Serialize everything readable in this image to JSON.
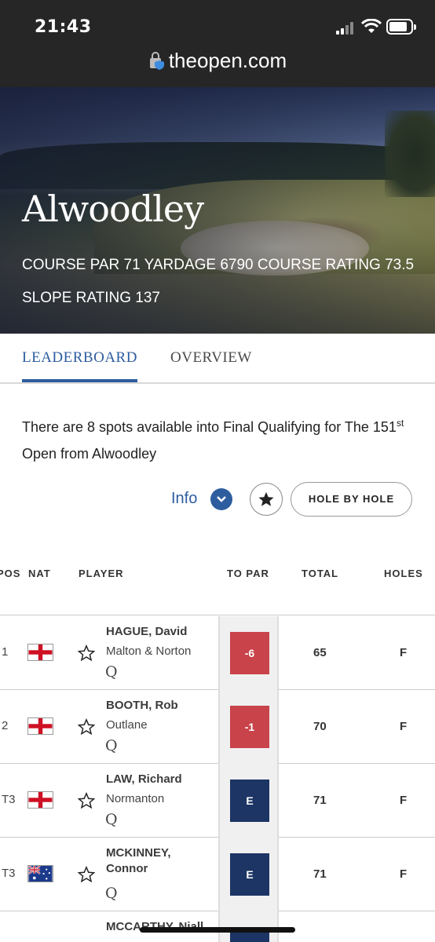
{
  "status_bar": {
    "time": "21:43"
  },
  "browser": {
    "url": "theopen.com"
  },
  "hero": {
    "title": "Alwoodley",
    "course_info": "COURSE PAR 71 YARDAGE 6790 COURSE RATING 73.5 SLOPE RATING 137"
  },
  "tabs": [
    {
      "label": "LEADERBOARD",
      "active": true
    },
    {
      "label": "OVERVIEW",
      "active": false
    }
  ],
  "intro": {
    "text_before": "There are 8 spots available into Final Qualifying for The 151",
    "superscript": "st",
    "text_after": " Open from Alwoodley"
  },
  "controls": {
    "info_label": "Info",
    "hole_by_hole_label": "HOLE BY HOLE"
  },
  "table": {
    "headers": {
      "pos": "POS",
      "nat": "NAT",
      "player": "PLAYER",
      "to_par": "TO PAR",
      "total": "TOTAL",
      "holes": "HOLES"
    },
    "rows": [
      {
        "pos": "1",
        "nat": "England",
        "name": "HAGUE, David",
        "club": "Malton & Norton",
        "qualifier": "Q",
        "to_par": "-6",
        "to_par_color": "#c9434a",
        "total": "65",
        "holes": "F"
      },
      {
        "pos": "2",
        "nat": "England",
        "name": "BOOTH, Rob",
        "club": "Outlane",
        "qualifier": "Q",
        "to_par": "-1",
        "to_par_color": "#c9434a",
        "total": "70",
        "holes": "F"
      },
      {
        "pos": "T3",
        "nat": "England",
        "name": "LAW, Richard",
        "club": "Normanton",
        "qualifier": "Q",
        "to_par": "E",
        "to_par_color": "#1c3564",
        "total": "71",
        "holes": "F"
      },
      {
        "pos": "T3",
        "nat": "Australia",
        "name": "MCKINNEY, Connor",
        "club": "",
        "qualifier": "Q",
        "to_par": "E",
        "to_par_color": "#1c3564",
        "total": "71",
        "holes": "F"
      },
      {
        "pos": "",
        "nat": "",
        "name": "MCCARTHY, Niall",
        "club": "",
        "qualifier": "",
        "to_par": "",
        "to_par_color": "#1c3564",
        "total": "",
        "holes": ""
      }
    ]
  }
}
